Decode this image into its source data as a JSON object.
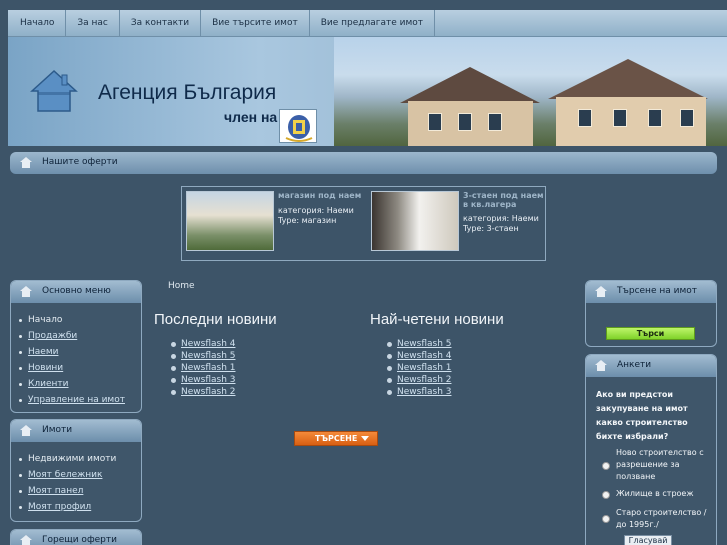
{
  "nav": {
    "items": [
      {
        "label": "Начало"
      },
      {
        "label": "За нас"
      },
      {
        "label": "За контакти"
      },
      {
        "label": "Вие търсите имот"
      },
      {
        "label": "Вие предлагате имот"
      }
    ]
  },
  "header": {
    "title": "Агенция България",
    "member_text": "член на"
  },
  "offers": {
    "title": "Нашите оферти",
    "items": [
      {
        "title": "магазин под наем",
        "category": "категория: Наеми",
        "type": "Type: магазин"
      },
      {
        "title": "3-стаен под наем в кв.лагера",
        "category": "категория: Наеми",
        "type": "Type: 3-стаен"
      }
    ]
  },
  "main_menu": {
    "title": "Основно меню",
    "items": [
      {
        "label": "Начало"
      },
      {
        "label": "Продажби"
      },
      {
        "label": "Наеми"
      },
      {
        "label": "Новини"
      },
      {
        "label": "Клиенти"
      },
      {
        "label": "Управление на имот"
      }
    ]
  },
  "properties_menu": {
    "title": "Имоти",
    "items": [
      {
        "label": "Недвижими имоти"
      },
      {
        "label": "Моят бележник"
      },
      {
        "label": "Моят панел"
      },
      {
        "label": "Моят профил"
      }
    ]
  },
  "hot_offers": {
    "title": "Горещи оферти"
  },
  "breadcrumb": "Home",
  "latest_news": {
    "title": "Последни новини",
    "items": [
      "Newsflash 4",
      "Newsflash 5",
      "Newsflash 1",
      "Newsflash 3",
      "Newsflash 2"
    ]
  },
  "most_read": {
    "title": "Най-четени новини",
    "items": [
      "Newsflash 5",
      "Newsflash 4",
      "Newsflash 1",
      "Newsflash 2",
      "Newsflash 3"
    ]
  },
  "search_button": "ТЪРСЕНЕ",
  "property_search": {
    "title": "Търсене на имот",
    "button": "Търси"
  },
  "poll": {
    "title": "Анкети",
    "question": "Ако ви предстои закупуване на имот какво строителство бихте избрали?",
    "options": [
      {
        "label": "Ново строителство с разрешение за ползване"
      },
      {
        "label": "Жилище в строеж"
      },
      {
        "label": "Старо строителство /до 1995г./"
      }
    ],
    "vote_button": "Гласувай"
  }
}
